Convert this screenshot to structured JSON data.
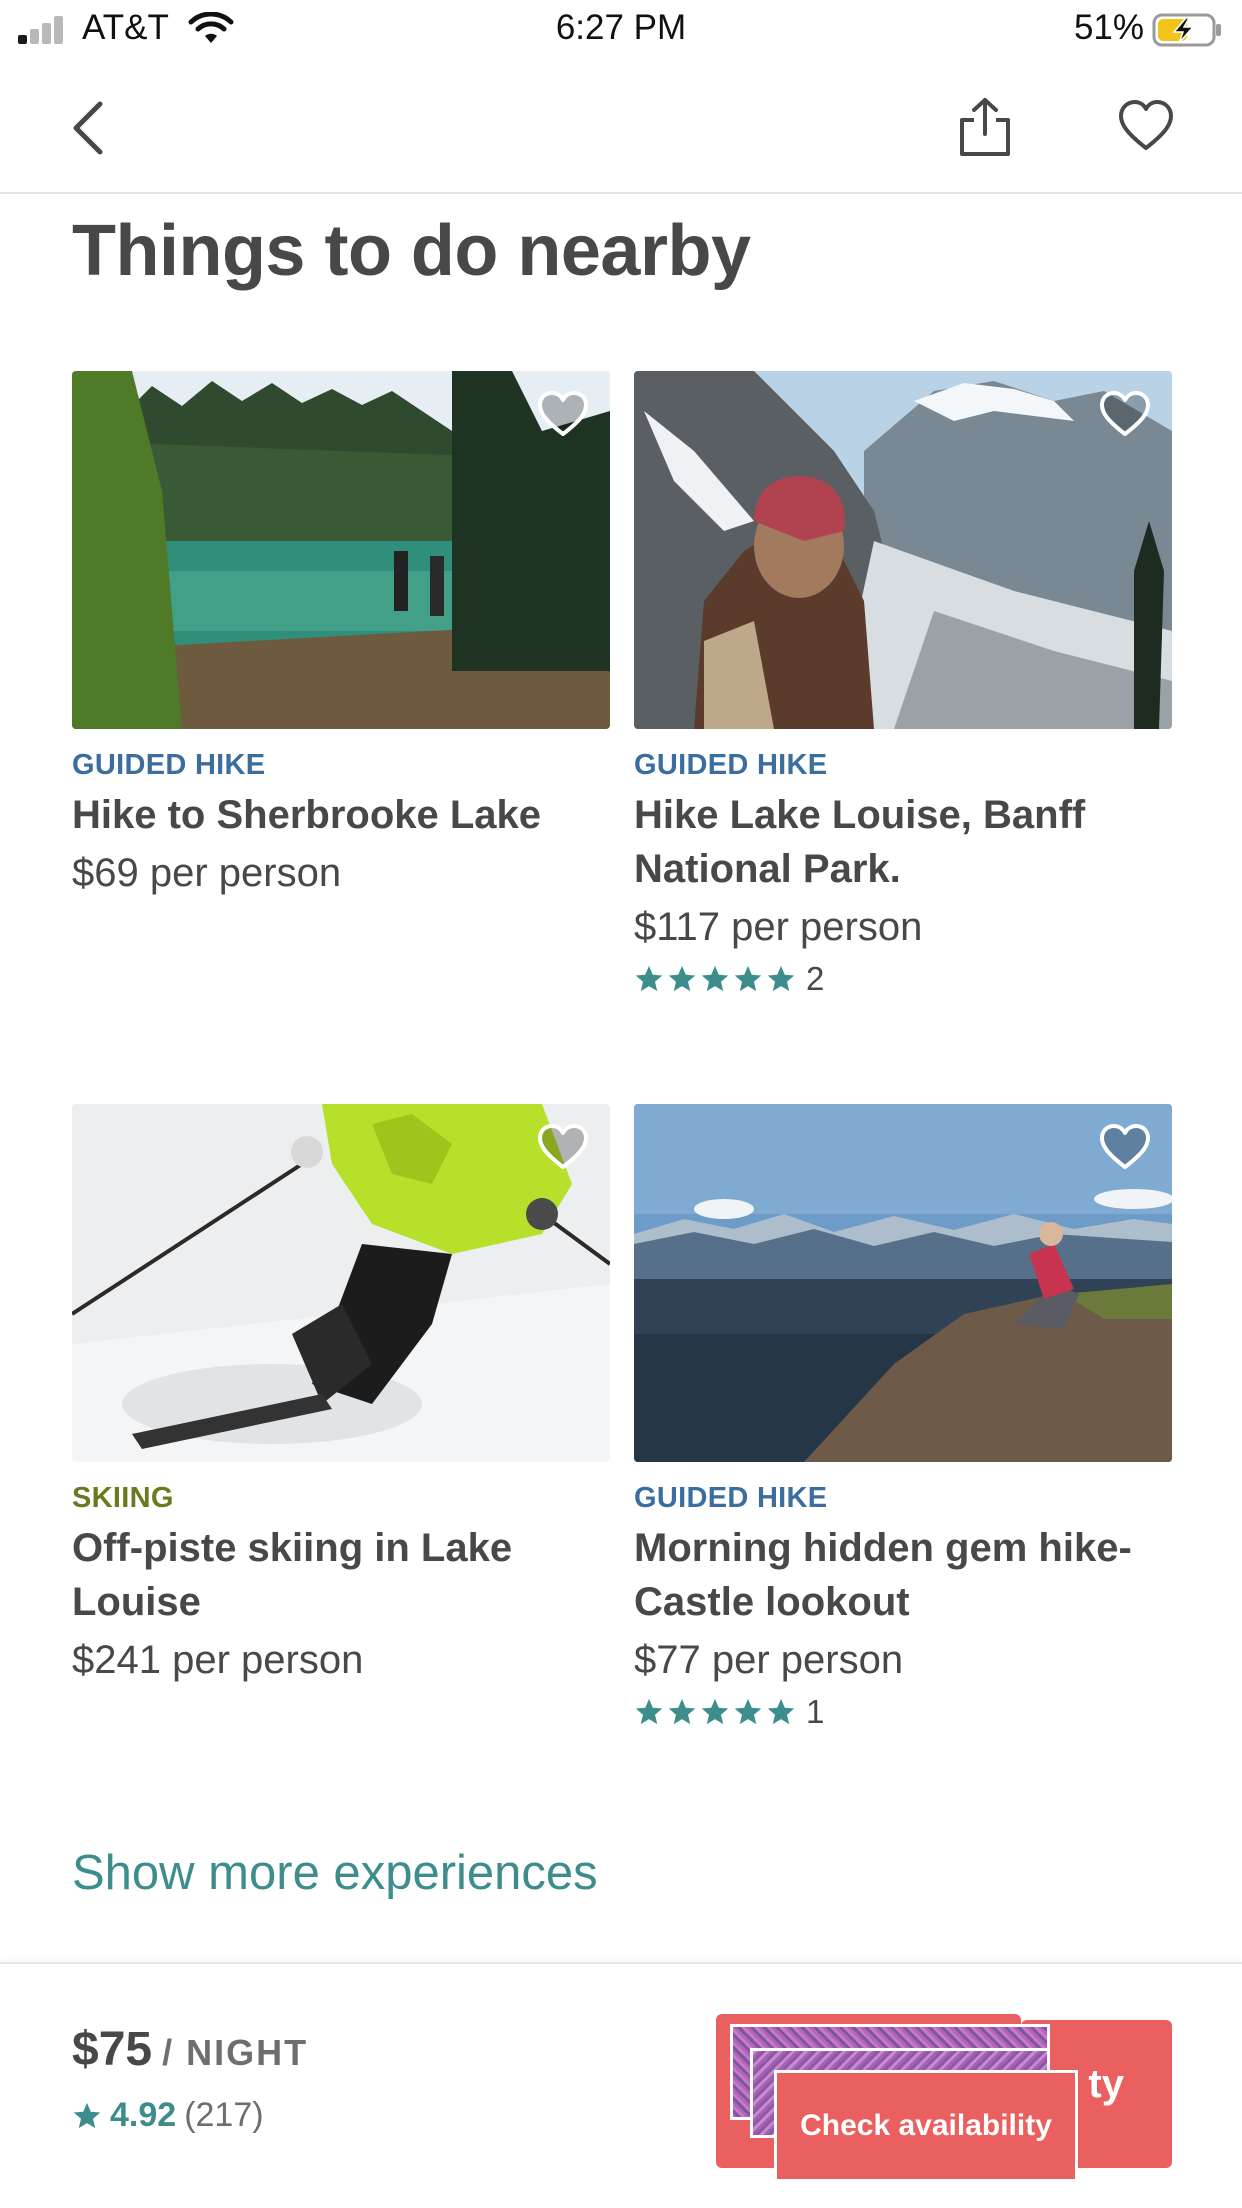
{
  "status_bar": {
    "carrier": "AT&T",
    "time": "6:27 PM",
    "battery_percent": "51%"
  },
  "nav": {
    "back_icon": "chevron-left-icon",
    "share_icon": "share-icon",
    "favorite_icon": "heart-icon"
  },
  "section": {
    "title": "Things to do nearby"
  },
  "experiences": [
    {
      "category": "GUIDED HIKE",
      "category_color": "#3b6e9e",
      "title": "Hike to Sherbrooke Lake",
      "price": "$69 per person"
    },
    {
      "category": "GUIDED HIKE",
      "category_color": "#3b6e9e",
      "title": "Hike Lake Louise, Banff National Park.",
      "price": "$117 per person",
      "rating_stars": 5,
      "review_count": "2"
    },
    {
      "category": "SKIING",
      "category_color": "#6b7a1e",
      "title": "Off-piste skiing in Lake Louise",
      "price": "$241 per person"
    },
    {
      "category": "GUIDED HIKE",
      "category_color": "#3b6e9e",
      "title": "Morning hidden gem hike-Castle lookout",
      "price": "$77 per person",
      "rating_stars": 5,
      "review_count": "1"
    }
  ],
  "show_more": "Show more experiences",
  "booking": {
    "price": "$75",
    "per": "/ NIGHT",
    "rating": "4.92",
    "reviews": "(217)",
    "button_label": "Check availability",
    "button_partial_label": "ty",
    "accent_color": "#ea5f5f",
    "teal_color": "#3c8d8b"
  }
}
